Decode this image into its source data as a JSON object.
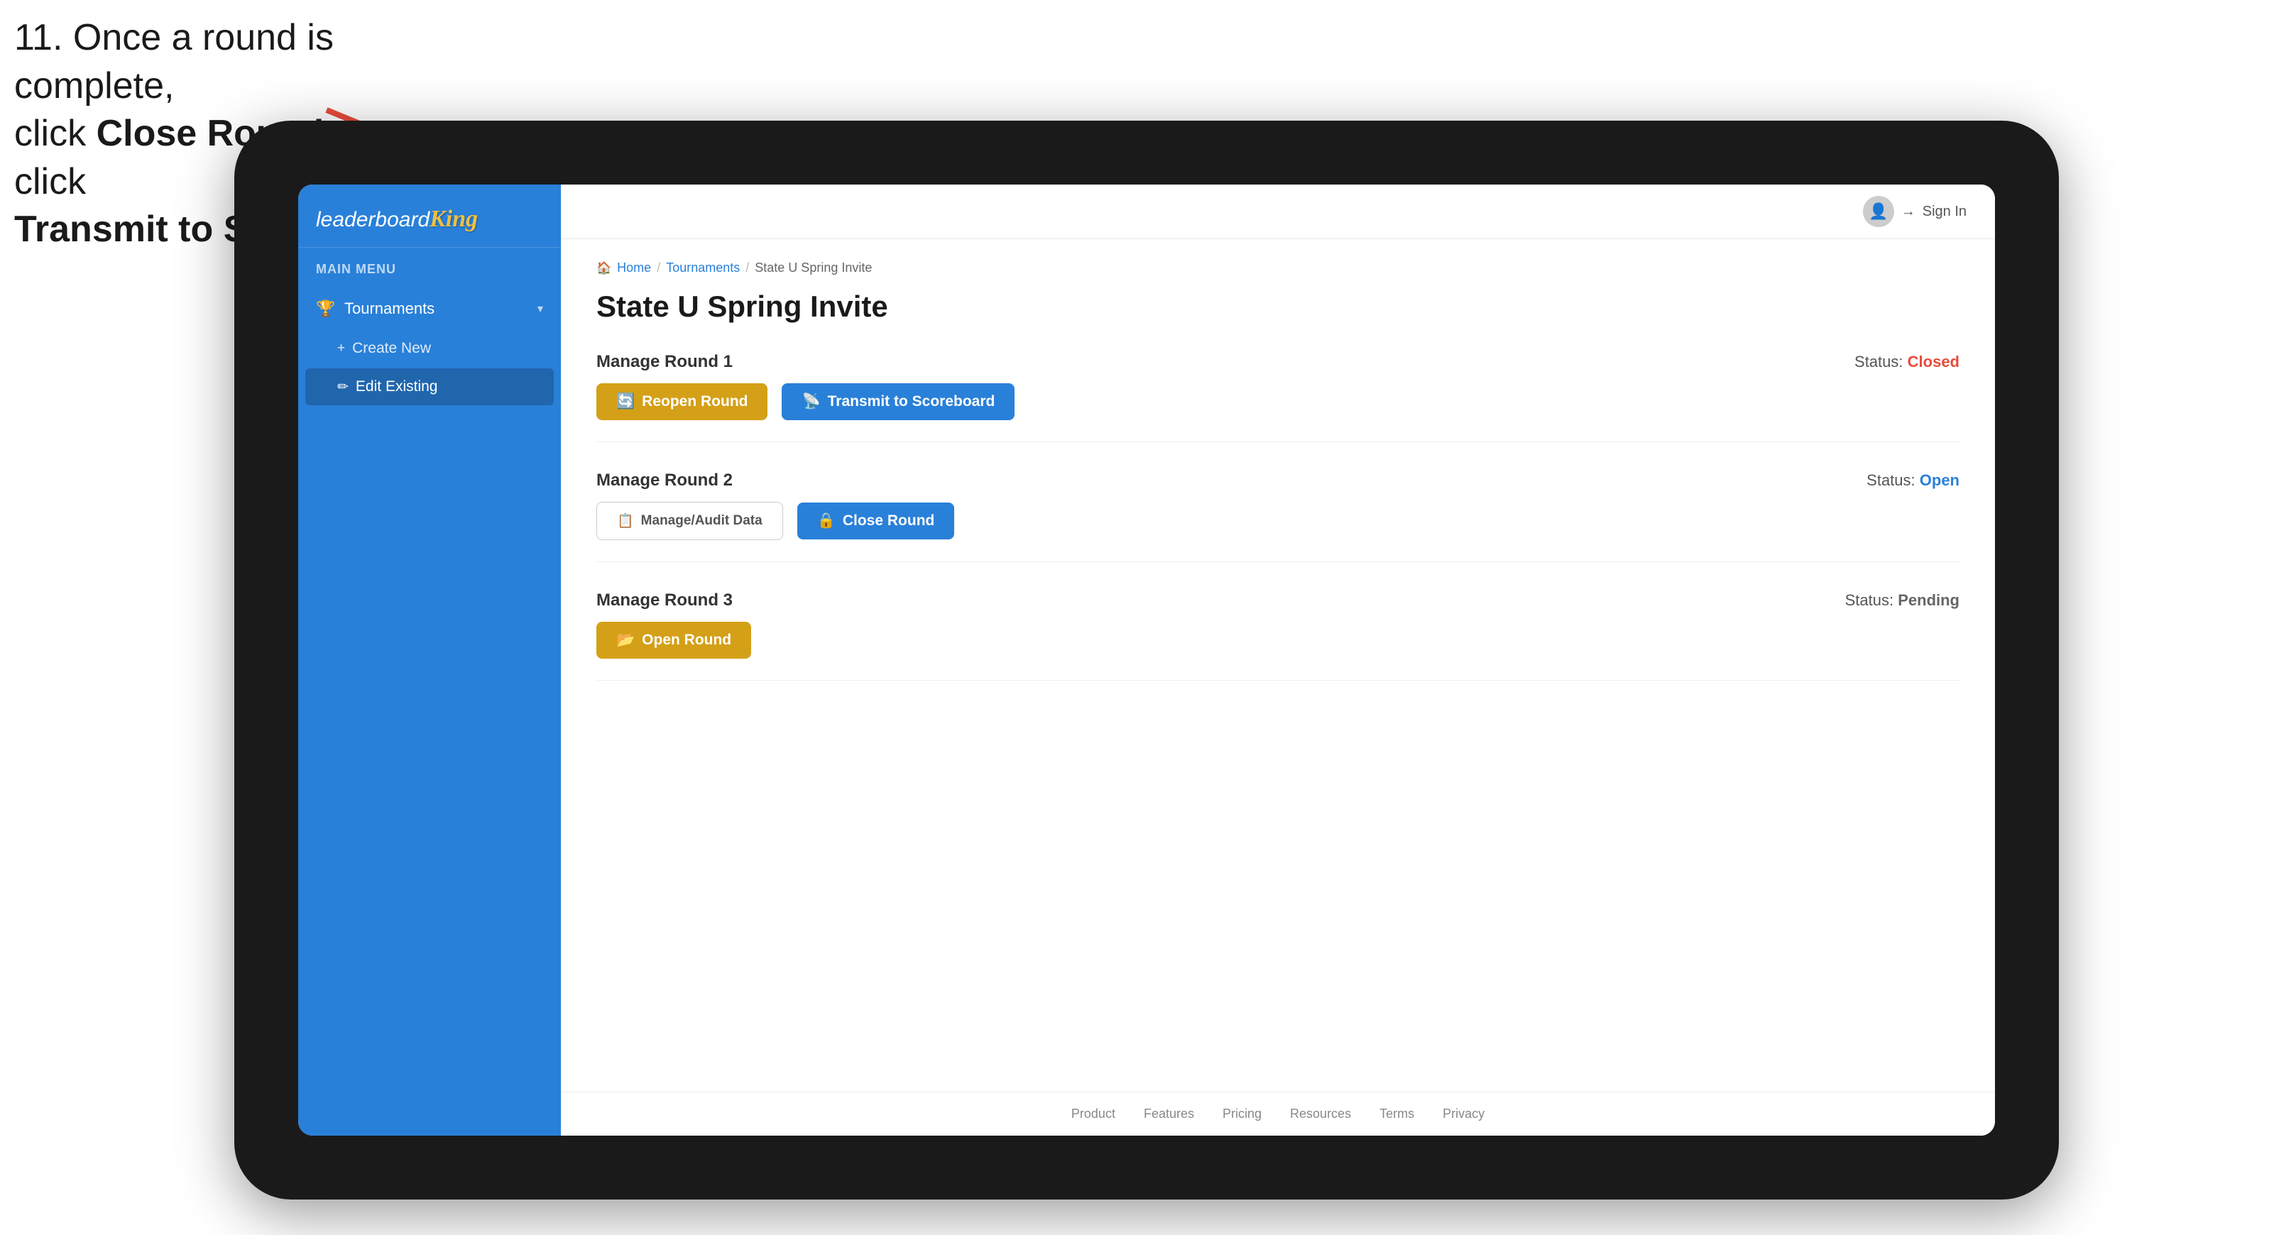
{
  "instruction": {
    "line1": "11. Once a round is complete,",
    "line2_prefix": "click ",
    "line2_bold": "Close Round",
    "line2_suffix": " then click",
    "line3_bold": "Transmit to Scoreboard."
  },
  "app": {
    "logo_leaderboard": "leaderboard",
    "logo_king": "King",
    "menu_label": "MAIN MENU"
  },
  "sidebar": {
    "nav_items": [
      {
        "label": "Tournaments",
        "icon": "🏆",
        "expanded": true
      }
    ],
    "sub_items": [
      {
        "label": "Create New",
        "icon": "+",
        "active": false
      },
      {
        "label": "Edit Existing",
        "icon": "✏",
        "active": true
      }
    ]
  },
  "topbar": {
    "sign_in": "Sign In"
  },
  "breadcrumb": {
    "home": "Home",
    "sep1": "/",
    "tournaments": "Tournaments",
    "sep2": "/",
    "current": "State U Spring Invite"
  },
  "page": {
    "title": "State U Spring Invite",
    "rounds": [
      {
        "label": "Manage Round 1",
        "status_label": "Status:",
        "status_value": "Closed",
        "status_class": "status-closed",
        "btn1_label": "Reopen Round",
        "btn1_icon": "🔄",
        "btn1_style": "btn-gold",
        "btn2_label": "Transmit to Scoreboard",
        "btn2_icon": "📡",
        "btn2_style": "btn-blue"
      },
      {
        "label": "Manage Round 2",
        "status_label": "Status:",
        "status_value": "Open",
        "status_class": "status-open",
        "btn1_label": "Manage/Audit Data",
        "btn1_icon": "📋",
        "btn1_style": "btn-outline",
        "btn2_label": "Close Round",
        "btn2_icon": "🔒",
        "btn2_style": "btn-blue"
      },
      {
        "label": "Manage Round 3",
        "status_label": "Status:",
        "status_value": "Pending",
        "status_class": "status-pending",
        "btn1_label": "Open Round",
        "btn1_icon": "📂",
        "btn1_style": "btn-gold",
        "btn2_label": null,
        "btn2_icon": null,
        "btn2_style": null
      }
    ]
  },
  "footer": {
    "links": [
      "Product",
      "Features",
      "Pricing",
      "Resources",
      "Terms",
      "Privacy"
    ]
  }
}
